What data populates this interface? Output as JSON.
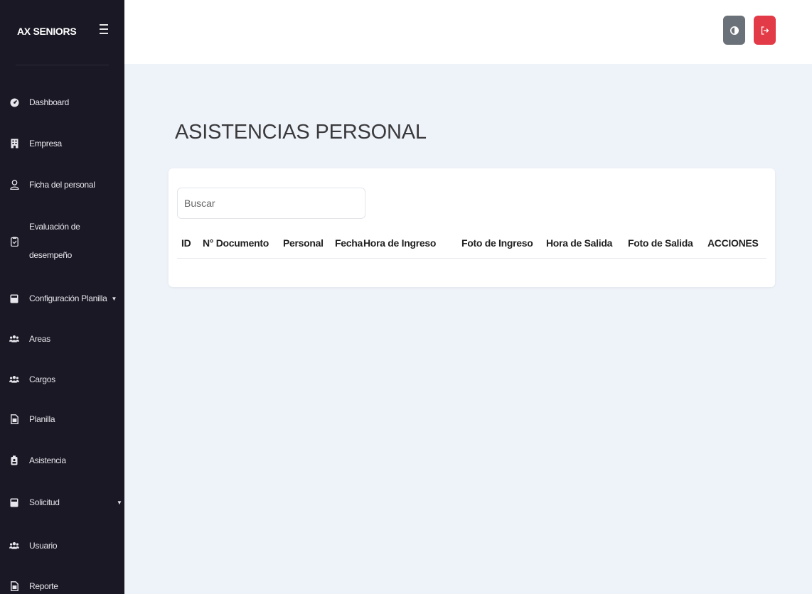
{
  "sidebar": {
    "brand": "AX SENIORS",
    "items": [
      {
        "label": "Dashboard",
        "icon": "dashboard-icon"
      },
      {
        "label": "Empresa",
        "icon": "building-icon"
      },
      {
        "label": "Ficha del personal",
        "icon": "user-icon"
      },
      {
        "label": "Evaluación de",
        "label2": "desempeño",
        "icon": "clipboard-icon"
      },
      {
        "label": "Configuración Planilla",
        "icon": "calculator-icon",
        "caret": "▼"
      },
      {
        "label": "Areas",
        "icon": "users-icon"
      },
      {
        "label": "Cargos",
        "icon": "users-icon"
      },
      {
        "label": "Planilla",
        "icon": "file-icon"
      },
      {
        "label": "Asistencia",
        "icon": "id-badge-icon"
      },
      {
        "label": "Solicitud",
        "icon": "calculator-icon",
        "caret": "▼"
      },
      {
        "label": "Usuario",
        "icon": "users-icon"
      },
      {
        "label": "Reporte",
        "icon": "file-icon"
      }
    ]
  },
  "topbar": {
    "theme_icon": "contrast-icon",
    "logout_icon": "logout-icon",
    "logout_color": "#e23b47",
    "theme_color": "#6b7178"
  },
  "main": {
    "title": "ASISTENCIAS PERSONAL",
    "search": {
      "placeholder": "Buscar",
      "value": ""
    },
    "columns": [
      "ID",
      "N° Documento",
      "Personal",
      "Fecha",
      "Hora de Ingreso",
      "Foto de Ingreso",
      "Hora de Salida",
      "Foto de Salida",
      "ACCIONES"
    ],
    "rows": []
  }
}
